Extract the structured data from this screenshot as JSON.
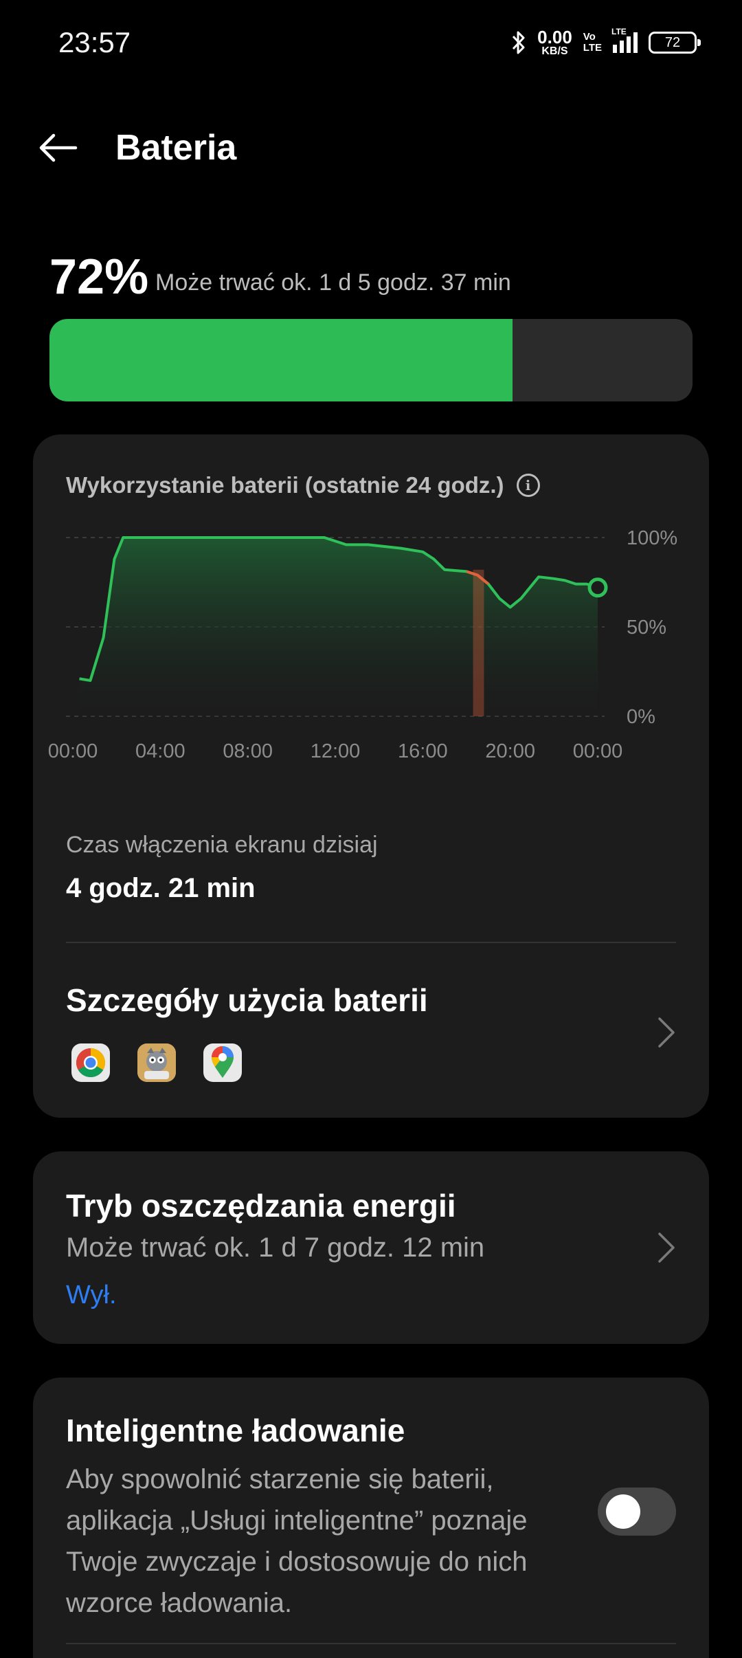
{
  "status_bar": {
    "time": "23:57",
    "net_speed_value": "0.00",
    "net_speed_unit": "KB/S",
    "volte_top": "Vo",
    "volte_bottom": "LTE",
    "signal_label": "LTE",
    "battery_level": "72"
  },
  "header": {
    "title": "Bateria",
    "back_icon": "arrow-left-icon"
  },
  "battery": {
    "percent_text": "72%",
    "level": 0.72,
    "estimate": "Może trwać ok. 1 d 5 godz. 37 min",
    "fill_color": "#2dbb56"
  },
  "usage_card": {
    "title": "Wykorzystanie baterii (ostatnie 24 godz.)",
    "info_icon": "info-icon",
    "screen_on_label": "Czas włączenia ekranu dzisiaj",
    "screen_on_value": "4 godz. 21 min",
    "details_title": "Szczegóły użycia baterii",
    "apps": [
      "chrome-icon",
      "game-app-icon",
      "google-maps-icon"
    ]
  },
  "chart_data": {
    "type": "area",
    "title": "Wykorzystanie baterii (ostatnie 24 godz.)",
    "x_tick_labels": [
      "00:00",
      "04:00",
      "08:00",
      "12:00",
      "16:00",
      "20:00",
      "00:00"
    ],
    "y_tick_labels": [
      "100%",
      "50%",
      "0%"
    ],
    "ylim": [
      0,
      100
    ],
    "xlim_hours": [
      0,
      24
    ],
    "series": [
      {
        "points": [
          [
            0.3,
            21
          ],
          [
            0.8,
            20
          ],
          [
            1.4,
            44
          ],
          [
            1.9,
            88
          ],
          [
            2.3,
            100
          ],
          [
            3,
            100
          ],
          [
            6,
            100
          ],
          [
            9,
            100
          ],
          [
            11.5,
            100
          ],
          [
            12.5,
            96
          ],
          [
            13.5,
            96
          ],
          [
            15,
            94
          ],
          [
            16,
            92
          ],
          [
            16.5,
            88
          ],
          [
            17,
            82
          ],
          [
            18,
            81
          ],
          [
            18.5,
            79
          ],
          [
            19,
            74
          ],
          [
            19.5,
            66
          ],
          [
            20,
            61
          ],
          [
            20.5,
            66
          ],
          [
            21.3,
            78
          ],
          [
            22,
            77
          ],
          [
            22.5,
            76
          ],
          [
            23,
            74
          ],
          [
            23.5,
            74
          ],
          [
            24,
            72
          ]
        ],
        "color": "#2fc05a"
      }
    ],
    "highlight_range_hours": [
      18.3,
      18.8
    ],
    "highlight_color": "#e2623e",
    "current_value": 72,
    "grid": true
  },
  "saver_card": {
    "title": "Tryb oszczędzania energii",
    "subtitle": "Może trwać ok. 1 d 7 godz. 12 min",
    "status": "Wył.",
    "status_color": "#2f7df2"
  },
  "smart_charging": {
    "title": "Inteligentne ładowanie",
    "description": "Aby spowolnić starzenie się baterii, aplikacja „Usługi inteligentne” poznaje Twoje zwyczaje i dostosowuje do nich wzorce ładowania.",
    "enabled": false
  }
}
